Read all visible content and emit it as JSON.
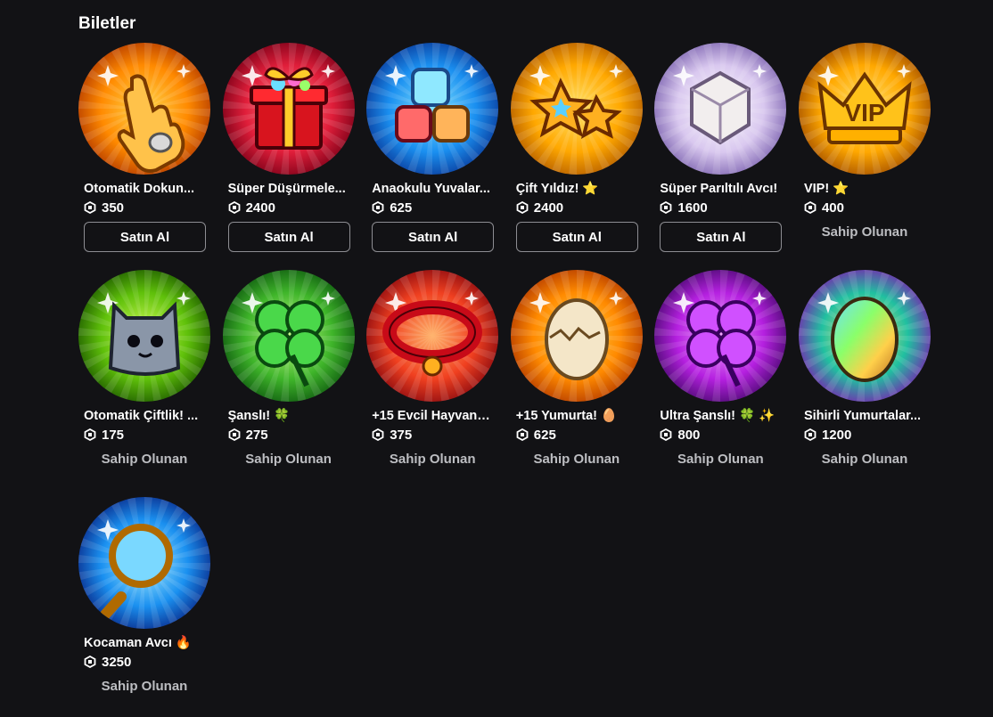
{
  "section": {
    "title": "Biletler"
  },
  "passes": [
    {
      "name": "Otomatik Dokun...",
      "emoji": "",
      "price": "350",
      "status": "buy",
      "action_label": "Satın Al",
      "icon": "tap-hand-icon",
      "bg": [
        "#ffd54a",
        "#ff8a00",
        "#b33a00"
      ]
    },
    {
      "name": "Süper Düşürmele...",
      "emoji": "",
      "price": "2400",
      "status": "buy",
      "action_label": "Satın Al",
      "icon": "gift-box-icon",
      "bg": [
        "#ff8a8a",
        "#e01e3a",
        "#7a0018"
      ]
    },
    {
      "name": "Anaokulu Yuvalar...",
      "emoji": "",
      "price": "625",
      "status": "buy",
      "action_label": "Satın Al",
      "icon": "toy-blocks-icon",
      "bg": [
        "#7fe3ff",
        "#1a8ff0",
        "#0a3a9a"
      ]
    },
    {
      "name": "Çift Yıldız!",
      "emoji": "⭐",
      "price": "2400",
      "status": "buy",
      "action_label": "Satın Al",
      "icon": "double-star-icon",
      "bg": [
        "#ffe36a",
        "#ffa800",
        "#b35c00"
      ]
    },
    {
      "name": "Süper Parıltılı Avcı!",
      "emoji": "",
      "price": "1600",
      "status": "buy",
      "action_label": "Satın Al",
      "icon": "shiny-dice-icon",
      "bg": [
        "#ffffff",
        "#d9c8ef",
        "#7d64b0"
      ]
    },
    {
      "name": "VIP!",
      "emoji": "⭐",
      "price": "400",
      "status": "owned",
      "action_label": "Sahip Olunan",
      "icon": "vip-crown-icon",
      "bg": [
        "#ffe36a",
        "#ffa800",
        "#a34f00"
      ]
    },
    {
      "name": "Otomatik Çiftlik! ...",
      "emoji": "",
      "price": "175",
      "status": "owned",
      "action_label": "Sahip Olunan",
      "icon": "cat-pet-icon",
      "bg": [
        "#d5ff5a",
        "#5fc00a",
        "#1e5a00"
      ]
    },
    {
      "name": "Şanslı!",
      "emoji": "🍀",
      "price": "275",
      "status": "owned",
      "action_label": "Sahip Olunan",
      "icon": "clover-icon",
      "bg": [
        "#caff8a",
        "#3fb52a",
        "#0f5a10"
      ]
    },
    {
      "name": "+15 Evcil Hayvan! ...",
      "emoji": "",
      "price": "375",
      "status": "owned",
      "action_label": "Sahip Olunan",
      "icon": "pet-collar-icon",
      "bg": [
        "#ffb36a",
        "#f04020",
        "#8a0a10"
      ]
    },
    {
      "name": "+15 Yumurta!",
      "emoji": "🥚",
      "price": "625",
      "status": "owned",
      "action_label": "Sahip Olunan",
      "icon": "cracked-egg-icon",
      "bg": [
        "#ffd54a",
        "#ff8a00",
        "#b33a00"
      ]
    },
    {
      "name": "Ultra Şanslı!",
      "emoji": "🍀 ✨",
      "price": "800",
      "status": "owned",
      "action_label": "Sahip Olunan",
      "icon": "purple-clover-icon",
      "bg": [
        "#f3a6ff",
        "#b520e0",
        "#4a0a70"
      ]
    },
    {
      "name": "Sihirli Yumurtalar...",
      "emoji": "",
      "price": "1200",
      "status": "owned",
      "action_label": "Sahip Olunan",
      "icon": "rainbow-egg-icon",
      "bg": [
        "#ffe36a",
        "#20c0a0",
        "#7a20b0"
      ]
    },
    {
      "name": "Kocaman Avcı",
      "emoji": "🔥",
      "price": "3250",
      "status": "owned",
      "action_label": "Sahip Olunan",
      "icon": "magnifier-icon",
      "bg": [
        "#a8f0ff",
        "#1a90f0",
        "#0a2a8a"
      ]
    }
  ]
}
